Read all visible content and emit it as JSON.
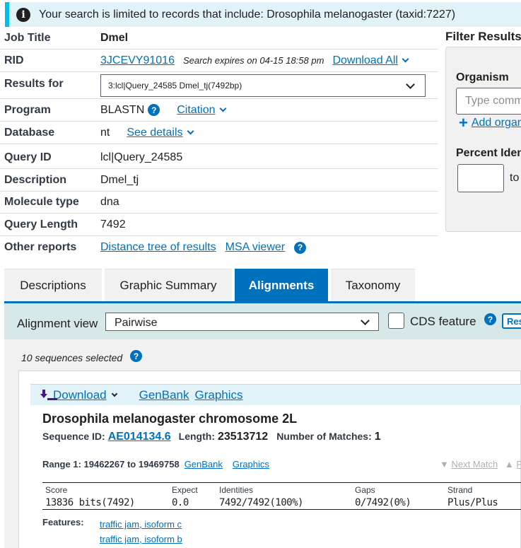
{
  "banner": {
    "text": "Your search is limited to records that include: Drosophila melanogaster (taxid:7227)"
  },
  "summary": {
    "job_title_label": "Job Title",
    "job_title": "Dmel",
    "rid_label": "RID",
    "rid": "3JCEVY91016",
    "expires": "Search expires on 04-15 18:58 pm",
    "download_all": "Download All",
    "results_for_label": "Results for",
    "results_for": "3:lcl|Query_24585 Dmel_tj(7492bp)",
    "program_label": "Program",
    "program": "BLASTN",
    "citation": "Citation",
    "database_label": "Database",
    "database": "nt",
    "see_details": "See details",
    "query_id_label": "Query ID",
    "query_id": "lcl|Query_24585",
    "description_label": "Description",
    "description": "Dmel_tj",
    "molecule_type_label": "Molecule type",
    "molecule_type": "dna",
    "query_length_label": "Query Length",
    "query_length": "7492",
    "other_reports_label": "Other reports",
    "distance_tree": "Distance tree of results",
    "msa_viewer": "MSA viewer"
  },
  "filter": {
    "title": "Filter Results",
    "organism_label": "Organism",
    "organism_placeholder": "Type common name",
    "add_organism": "Add organism",
    "percent_identity_label": "Percent Identity",
    "to": "to"
  },
  "tabs": [
    {
      "label": "Descriptions",
      "active": false
    },
    {
      "label": "Graphic Summary",
      "active": false
    },
    {
      "label": "Alignments",
      "active": true
    },
    {
      "label": "Taxonomy",
      "active": false
    }
  ],
  "alignment_bar": {
    "view_label": "Alignment view",
    "view_value": "Pairwise",
    "cds_label": "CDS feature",
    "reset_label": "Reset"
  },
  "results": {
    "selected_text": "10 sequences selected",
    "download": "Download",
    "genbank": "GenBank",
    "graphics": "Graphics",
    "title": "Drosophila melanogaster chromosome 2L",
    "sequence_id_label": "Sequence ID:",
    "sequence_id": "AE014134.6",
    "length_label": "Length:",
    "length": "23513712",
    "matches_label": "Number of Matches:",
    "matches": "1",
    "range_text": "Range 1: 19462267 to 19469758",
    "range_genbank": "GenBank",
    "range_graphics": "Graphics",
    "next_match": "Next Match",
    "prev_match": "P",
    "stats_headers": [
      "Score",
      "Expect",
      "Identities",
      "Gaps",
      "Strand"
    ],
    "stats_values": [
      "13836 bits(7492)",
      "0.0",
      "7492/7492(100%)",
      "0/7492(0%)",
      "Plus/Plus"
    ],
    "features_label": "Features:",
    "features": [
      "traffic jam, isoform c",
      "traffic jam, isoform b"
    ]
  },
  "colors": {
    "link": "#0071bc",
    "active_tab": "#0071bc",
    "banner_bg": "#e1f3f8",
    "banner_accent": "#02bfe7",
    "alignment_bar_bg": "#d6e8e7"
  }
}
